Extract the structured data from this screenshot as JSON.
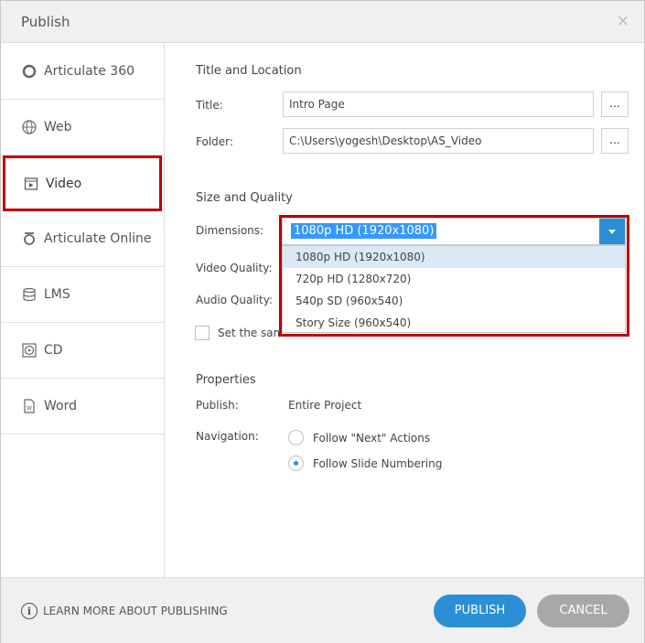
{
  "window": {
    "title": "Publish",
    "close_glyph": "×"
  },
  "sidebar": {
    "items": [
      {
        "label": "Articulate 360",
        "icon": "articulate-360-icon"
      },
      {
        "label": "Web",
        "icon": "globe-icon"
      },
      {
        "label": "Video",
        "icon": "video-icon"
      },
      {
        "label": "Articulate Online",
        "icon": "articulate-online-icon"
      },
      {
        "label": "LMS",
        "icon": "database-icon"
      },
      {
        "label": "CD",
        "icon": "cd-icon"
      },
      {
        "label": "Word",
        "icon": "word-document-icon"
      }
    ],
    "active": "Video"
  },
  "title_location": {
    "heading": "Title and Location",
    "title_label": "Title:",
    "title_value": "Intro Page",
    "folder_label": "Folder:",
    "folder_value": "C:\\Users\\yogesh\\Desktop\\AS_Video",
    "browse_label": "..."
  },
  "size_quality": {
    "heading": "Size and Quality",
    "dimensions_label": "Dimensions:",
    "dimensions_value": "1080p HD (1920x1080)",
    "video_quality_label": "Video Quality:",
    "audio_quality_label": "Audio Quality:",
    "options": [
      "1080p HD (1920x1080)",
      "720p HD (1280x720)",
      "540p SD (960x540)",
      "Story Size (960x540)"
    ],
    "checkbox_label": "Set the same"
  },
  "properties": {
    "heading": "Properties",
    "publish_label": "Publish:",
    "publish_value": "Entire Project",
    "navigation_label": "Navigation:",
    "nav_options": [
      "Follow \"Next\" Actions",
      "Follow Slide Numbering"
    ],
    "nav_selected_index": 1
  },
  "footer": {
    "learn_icon_glyph": "i",
    "learn_more": "LEARN MORE ABOUT PUBLISHING",
    "publish_button": "PUBLISH",
    "cancel_button": "CANCEL"
  },
  "colors": {
    "accent": "#2b8fd6",
    "highlight": "#c00000",
    "selection": "#3399ff"
  }
}
